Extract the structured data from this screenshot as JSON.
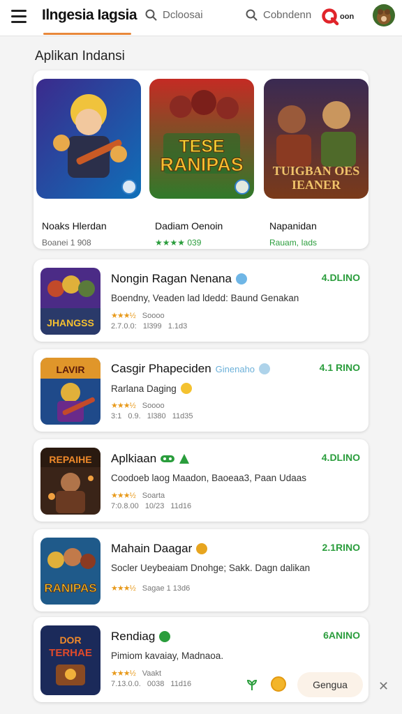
{
  "header": {
    "title": "Ilngesia Iagsia",
    "search_primary": "Dcloosai",
    "search_secondary": "Cobndenn",
    "logo_text": "oon"
  },
  "section": {
    "title": "Aplikan Indansi"
  },
  "featured": [
    {
      "name": "Noaks Hlerdan",
      "meta": "Boanei 1 908",
      "meta_style": "gray",
      "art_text": ""
    },
    {
      "name": "Dadiam Oenoin",
      "meta": "★★★★ 039",
      "meta_style": "green",
      "art_text": "TESE RANIPAS"
    },
    {
      "name": "Napanidan",
      "meta": "Rauam, Iads",
      "meta_style": "green",
      "art_text": "TUIGBAN OES IEANER"
    }
  ],
  "apps": [
    {
      "name": "Nongin Ragan Nenana",
      "desc": "Boendny, Veaden lad ldedd: Baund Genakan",
      "stars": "★★★½",
      "rating": "Soooo",
      "sub": "2.7.0.0: 1l399 1.1d3",
      "price": "4.DLINO",
      "tag": "",
      "art_text": "JHANGSS"
    },
    {
      "name": "Casgir Phapeciden",
      "desc": "Rarlana Daging",
      "stars": "★★★½",
      "rating": "Soooo",
      "sub": "3:1 0.9. 1l380 11d35",
      "price": "4.1 RINO",
      "tag": "Ginenaho",
      "art_text": "LAVIR"
    },
    {
      "name": "Aplkiaan",
      "desc": "Coodoeb laog Maadon, Baoeaa3, Paan Udaas",
      "stars": "★★★½",
      "rating": "Soarta",
      "sub": "7:0.8.00 10/23 11d16",
      "price": "4.DLINO",
      "tag": "",
      "art_text": "REPAIHE"
    },
    {
      "name": "Mahain Daagar",
      "desc": "Socler Ueybeaiam Dnohge; Sakk. Dagn dalikan",
      "stars": "★★★½",
      "rating": "Sagae 1 13d6",
      "sub": "",
      "price": "2.1RINO",
      "tag": "",
      "art_text": "RANIPAS"
    },
    {
      "name": "Rendiag",
      "desc": "Pimiom kavaiay, Madnaoa.",
      "stars": "★★★½",
      "rating": "Vaakt",
      "sub": "7.13.0.0. 0038 11d16",
      "price": "6ANINO",
      "tag": "",
      "art_text": "TERHAE"
    }
  ],
  "bottom_bar": {
    "button_label": "Gengua",
    "close_label": "✕"
  },
  "colors": {
    "accent": "#e8883a",
    "price_green": "#2a9d3c",
    "star_orange": "#e89a1c",
    "background": "#f4f4f4"
  }
}
